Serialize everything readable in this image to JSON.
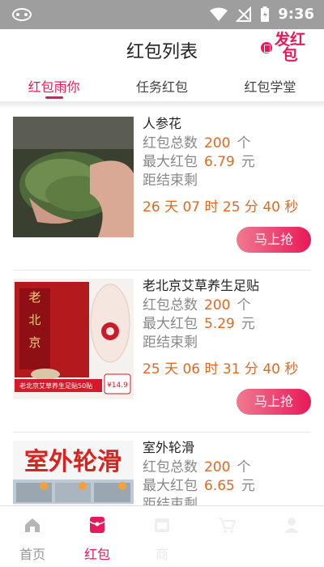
{
  "status_bar": {
    "time": "9:36"
  },
  "header": {
    "title": "红包列表",
    "send_label": "发红包"
  },
  "tabs": [
    {
      "label": "红包雨你",
      "active": true
    },
    {
      "label": "任务红包",
      "active": false
    },
    {
      "label": "红包学堂",
      "active": false
    }
  ],
  "list": {
    "field_total": "红包总数",
    "field_max": "最大红包",
    "field_remaining": "距结束剩",
    "unit_count": "个",
    "unit_money": "元",
    "grab_label": "马上抢",
    "items": [
      {
        "name": "人参花",
        "total": "200",
        "max": "6.79",
        "countdown": "26 天 07 时 25 分 40 秒"
      },
      {
        "name": "老北京艾草养生足贴",
        "total": "200",
        "max": "5.29",
        "countdown": "25 天 06 时 31 分 40 秒",
        "image_text": {
          "brand": "老北京",
          "banner": "老北京艾草养生足贴50贴",
          "price_tag": "¥14.9"
        }
      },
      {
        "name": "室外轮滑",
        "total": "200",
        "max": "6.65",
        "image_text": {
          "headline": "室外轮滑"
        }
      }
    ]
  },
  "bottom_nav": [
    {
      "label": "首页",
      "icon": "home-icon",
      "active": false
    },
    {
      "label": "红包",
      "icon": "red-packet-icon",
      "active": true
    },
    {
      "label": "商",
      "icon": "shop-icon",
      "active": false
    },
    {
      "label": "",
      "icon": "cart-icon",
      "active": false
    },
    {
      "label": "",
      "icon": "user-icon",
      "active": false
    }
  ],
  "colors": {
    "accent": "#e8195a",
    "highlight": "#e2691f",
    "status_bar": "#9e9e9e"
  }
}
